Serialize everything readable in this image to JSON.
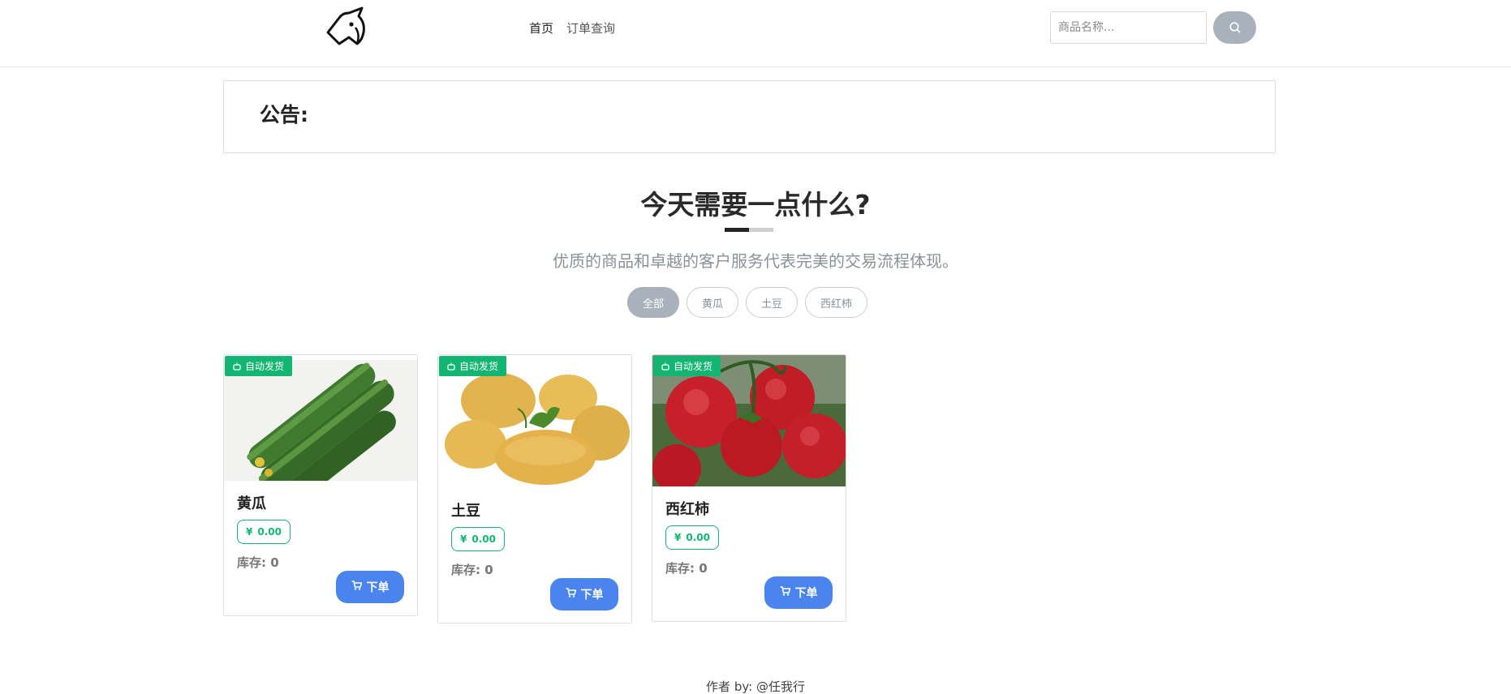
{
  "nav": {
    "logo_icon": "unicorn-logo-icon",
    "home": "首页",
    "order_query": "订单查询"
  },
  "search": {
    "placeholder": "商品名称...",
    "button_icon": "search-icon"
  },
  "notice": {
    "title": "公告:"
  },
  "section": {
    "title": "今天需要一点什么?",
    "subtitle": "优质的商品和卓越的客户服务代表完美的交易流程体现。"
  },
  "filters": {
    "all": "全部",
    "cucumber": "黄瓜",
    "potato": "土豆",
    "tomato": "西红柿"
  },
  "products": [
    {
      "name": "黄瓜",
      "badge": "自动发货",
      "price": "0.00",
      "stock_label": "库存:",
      "stock": "0",
      "order_label": "下单"
    },
    {
      "name": "土豆",
      "badge": "自动发货",
      "price": "0.00",
      "stock_label": "库存:",
      "stock": "0",
      "order_label": "下单"
    },
    {
      "name": "西红柿",
      "badge": "自动发货",
      "price": "0.00",
      "stock_label": "库存:",
      "stock": "0",
      "order_label": "下单"
    }
  ],
  "footer": {
    "text": "作者 by: @任我行"
  },
  "colors": {
    "accent_green": "#12b572",
    "order_blue": "#4a84ef",
    "muted_gray": "#a9b2bb"
  }
}
